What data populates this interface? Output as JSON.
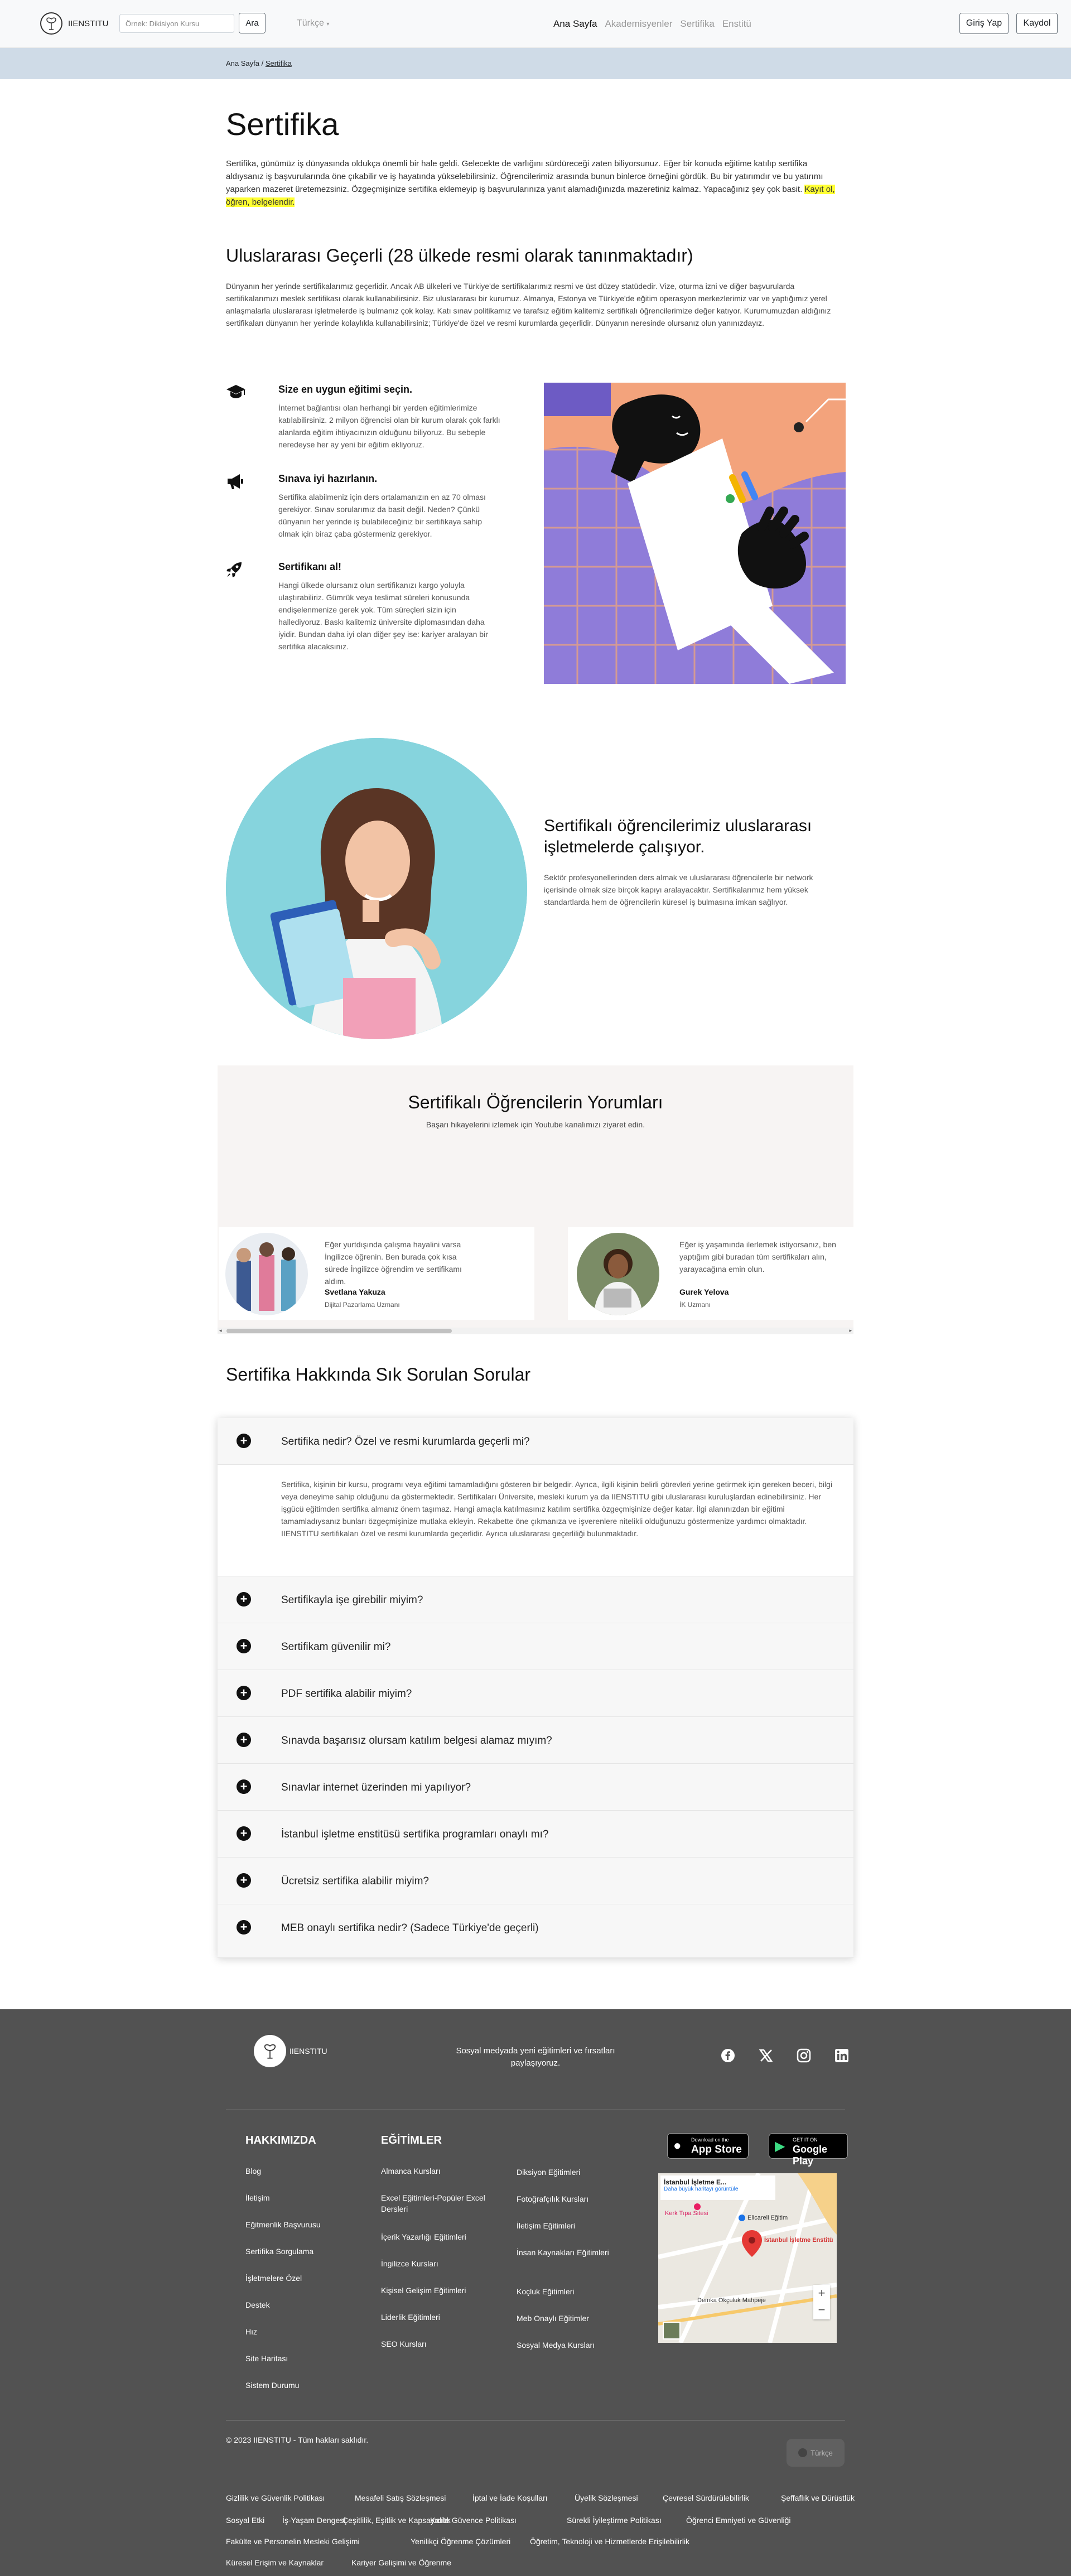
{
  "header": {
    "logo_text": "IIENSTITU",
    "search_placeholder": "Örnek: Dikisiyon Kursu",
    "search_button": "Ara",
    "language": "Türkçe",
    "nav": [
      "Ana Sayfa",
      "Akademisyenler",
      "Sertifika",
      "Enstitü"
    ],
    "login": "Giriş Yap",
    "register": "Kaydol"
  },
  "breadcrumb": {
    "home": "Ana Sayfa",
    "sep": " / ",
    "current": "Sertifika"
  },
  "page_title": "Sertifika",
  "intro": {
    "text": "Sertifika, günümüz iş dünyasında oldukça önemli bir hale geldi. Gelecekte de varlığını sürdüreceği zaten biliyorsunuz. Eğer bir konuda eğitime katılıp sertifika aldıysanız iş başvurularında öne çıkabilir ve iş hayatında yükselebilirsiniz. Öğrencilerimiz arasında bunun binlerce örneğini gördük. Bu bir yatırımdır ve bu yatırımı yaparken mazeret üretemezsiniz. Özgeçmişinize sertifika eklemeyip iş başvurularınıza yanıt alamadığınızda mazeretiniz kalmaz. Yapacağınız şey çok basit.",
    "highlight": "Kayıt ol, öğren, belgelendir."
  },
  "intl": {
    "title": "Uluslararası Geçerli (28 ülkede resmi olarak tanınmaktadır)",
    "text": "Dünyanın her yerinde sertifikalarımız geçerlidir. Ancak AB ülkeleri ve Türkiye'de sertifikalarımız resmi ve üst düzey statüdedir. Vize, oturma izni ve diğer başvurularda sertifikalarımızı meslek sertifikası olarak kullanabilirsiniz. Biz uluslararası bir kurumuz. Almanya, Estonya ve Türkiye'de eğitim operasyon merkezlerimiz var ve yaptığımız yerel anlaşmalarla uluslararası işletmelerde iş bulmanız çok kolay. Katı sınav politikamız ve tarafsız eğitim kalitemiz sertifikalı öğrencilerimize değer katıyor. Kurumumuzdan aldığınız sertifikaları dünyanın her yerinde kolaylıkla kullanabilirsiniz; Türkiye'de özel ve resmi kurumlarda geçerlidir. Dünyanın neresinde olursanız olun yanınızdayız."
  },
  "features": [
    {
      "icon": "graduation-cap-icon",
      "title": "Size en uygun eğitimi seçin.",
      "text": "İnternet bağlantısı olan herhangi bir yerden eğitimlerimize katılabilirsiniz. 2 milyon öğrencisi olan bir kurum olarak çok farklı alanlarda eğitim ihtiyacınızın olduğunu biliyoruz. Bu sebeple neredeyse her ay yeni bir eğitim ekliyoruz."
    },
    {
      "icon": "megaphone-icon",
      "title": "Sınava iyi hazırlanın.",
      "text": "Sertifika alabilmeniz için ders ortalamanızın en az 70 olması gerekiyor. Sınav sorularımız da basit değil. Neden? Çünkü dünyanın her yerinde iş bulabileceğiniz bir sertifikaya sahip olmak için biraz çaba göstermeniz gerekiyor."
    },
    {
      "icon": "rocket-icon",
      "title": "Sertifikanı al!",
      "text": "Hangi ülkede olursanız olun sertifikanızı kargo yoluyla ulaştırabiliriz. Gümrük veya teslimat süreleri konusunda endişelenmenize gerek yok. Tüm süreçleri sizin için hallediyoruz. Baskı kalitemiz üniversite diplomasından daha iyidir. Bundan daha iyi olan diğer şey ise: kariyer aralayan bir sertifika alacaksınız."
    }
  ],
  "working": {
    "title": "Sertifikalı öğrencilerimiz uluslararası işletmelerde çalışıyor.",
    "text": "Sektör profesyonellerinden ders almak ve uluslararası öğrencilerle bir network içerisinde olmak size birçok kapıyı aralayacaktır. Sertifikalarımız hem yüksek standartlarda hem de öğrencilerin küresel iş bulmasına imkan sağlıyor."
  },
  "reviews": {
    "title": "Sertifikalı Öğrencilerin Yorumları",
    "subtitle": "Başarı hikayelerini izlemek için Youtube kanalımızı ziyaret edin.",
    "items": [
      {
        "quote": "Eğer yurtdışında çalışma hayalini varsa İngilizce öğrenin. Ben burada çok kısa sürede İngilizce öğrendim ve sertifikamı aldım.",
        "name": "Svetlana Yakuza",
        "role": "Dijital Pazarlama Uzmanı"
      },
      {
        "quote": "Eğer iş yaşamında ilerlemek istiyorsanız, ben yaptığım gibi buradan tüm sertifikaları alın, yarayacağına emin olun.",
        "name": "Gurek Yelova",
        "role": "İK Uzmanı"
      }
    ]
  },
  "faq": {
    "title": "Sertifika Hakkında Sık Sorulan Sorular",
    "open_question": "Sertifika nedir? Özel ve resmi kurumlarda geçerli mi?",
    "open_answer": "Sertifika, kişinin bir kursu, programı veya eğitimi tamamladığını gösteren bir belgedir. Ayrıca, ilgili kişinin belirli görevleri yerine getirmek için gereken beceri, bilgi veya deneyime sahip olduğunu da göstermektedir. Sertifikaları Üniversite, mesleki kurum ya da IIENSTITU gibi uluslararası kuruluşlardan edinebilirsiniz. Her işgücü eğitimden sertifika almanız önem taşımaz. Hangi amaçla katılmasınız katılım sertifika özgeçmişinize değer katar. İlgi alanınızdan bir eğitimi tamamladıysanız bunları özgeçmişinize mutlaka ekleyin. Rekabette öne çıkmanıza ve işverenlere nitelikli olduğunuzu göstermenize yardımcı olmaktadır. IIENSTITU sertifikaları özel ve resmi kurumlarda geçerlidir. Ayrıca uluslararası geçerliliği bulunmaktadır.",
    "questions": [
      "Sertifikayla işe girebilir miyim?",
      "Sertifikam güvenilir mi?",
      "PDF sertifika alabilir miyim?",
      "Sınavda başarısız olursam katılım belgesi alamaz mıyım?",
      "Sınavlar internet üzerinden mi yapılıyor?",
      "İstanbul işletme enstitüsü sertifika programları onaylı mı?",
      "Ücretsiz sertifika alabilir miyim?",
      "MEB onaylı sertifika nedir? (Sadece Türkiye'de geçerli)"
    ]
  },
  "footer": {
    "logo_text": "IIENSTITU",
    "social_text": "Sosyal medyada yeni eğitimleri ve fırsatları paylaşıyoruz.",
    "about_title": "HAKKIMIZDA",
    "about_links": [
      "Blog",
      "İletişim",
      "Eğitmenlik Başvurusu",
      "Sertifika Sorgulama",
      "İşletmelere Özel",
      "Destek",
      "Hız",
      "Site Haritası",
      "Sistem Durumu"
    ],
    "edu_title": "EĞİTİMLER",
    "edu_col1": [
      "Almanca Kursları",
      "Excel Eğitimleri-Popüler Excel Dersleri",
      "İçerik Yazarlığı Eğitimleri",
      "İngilizce Kursları",
      "Kişisel Gelişim Eğitimleri",
      "Liderlik Eğitimleri",
      "SEO Kursları"
    ],
    "edu_col2": [
      "Diksiyon Eğitimleri",
      "Fotoğrafçılık Kursları",
      "İletişim Eğitimleri",
      "İnsan Kaynakları Eğitimleri",
      "Koçluk Eğitimleri",
      "Meb Onaylı Eğitimler",
      "Sosyal Medya Kursları"
    ],
    "app_store": "App Store",
    "app_store_small": "Download on the",
    "google_play": "Google Play",
    "google_play_small": "GET IT ON",
    "map_title": "İstanbul İşletme E...",
    "map_link": "Daha büyük haritayı görüntüle",
    "map_pin": "İstanbul İşletme Enstitü",
    "map_labels": [
      "Kerk Tıpa Sitesi",
      "Elicareli Eğitim",
      "Demka Okçuluk Mahpeje"
    ],
    "copyright": "© 2023 IIENSTITU - Tüm hakları saklıdır.",
    "lang_button": "Türkçe",
    "legal": [
      "Gizlilik ve Güvenlik Politikası",
      "Mesafeli Satış Sözleşmesi",
      "İptal ve İade Koşulları",
      "Üyelik Sözleşmesi",
      "Çevresel Sürdürülebilirlik",
      "Şeffaflık ve Dürüstlük",
      "Sosyal Etki",
      "İş-Yaşam Dengesi",
      "Çeşitlilik, Eşitlik ve Kapsayıcılık",
      "Kalite Güvence Politikası",
      "Sürekli İyileştirme Politikası",
      "Öğrenci Emniyeti ve Güvenliği",
      "Fakülte ve Personelin Mesleki Gelişimi",
      "Yenilikçi Öğrenme Çözümleri",
      "Öğretim, Teknoloji ve Hizmetlerde Erişilebilirlik",
      "Küresel Erişim ve Kaynaklar",
      "Kariyer Gelişimi ve Öğrenme"
    ]
  },
  "colors": {
    "accent_bar": "#cfdbe7",
    "highlight": "#ffff33",
    "footer_bg": "#525252",
    "art_bg": "#8f7cd9",
    "art_accent": "#f4a07a",
    "photo_bg": "#7dd0da"
  }
}
